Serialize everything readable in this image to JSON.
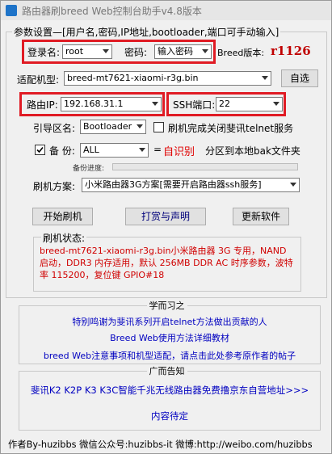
{
  "window": {
    "title": "路由器刷breed Web控制台助手v4.8版本"
  },
  "params": {
    "legend": "参数设置—[用户名,密码,IP地址,bootloader,端口可手动输入]"
  },
  "login": {
    "user_label": "登录名:",
    "user_value": "root",
    "pass_label": "密码:",
    "pass_value": "输入密码",
    "breed_label": "Breed版本:",
    "breed_value": "r1126"
  },
  "model": {
    "label": "适配机型:",
    "value": "breed-mt7621-xiaomi-r3g.bin",
    "button": "自选"
  },
  "network": {
    "ip_label": "路由IP:",
    "ip_value": "192.168.31.1",
    "ssh_label": "SSH端口:",
    "ssh_value": "22"
  },
  "boot": {
    "label": "引导区名:",
    "value": "Bootloader",
    "telnet_label": "刷机完成关闭斐讯telnet服务"
  },
  "backup": {
    "label": "备  份:",
    "value": "ALL",
    "equals": "=",
    "auto": "自识别",
    "partition": "分区到本地bak文件夹",
    "progress_label": "备份进度:",
    "progress": 0
  },
  "plan": {
    "label": "刷机方案:",
    "value": "小米路由器3G方案[需要开启路由器ssh服务]"
  },
  "actions": {
    "start": "开始刷机",
    "reward": "打赏与声明",
    "update": "更新软件"
  },
  "status": {
    "label": "刷机状态:",
    "text": "breed-mt7621-xiaomi-r3g.bin小米路由器 3G 专用，NAND 启动，DDR3 内存适用，默认 256MB DDR AC 时序参数，波特率 115200，复位键 GPIO#18"
  },
  "study": {
    "title": "学而习之",
    "line1": "特别鸣谢为斐讯系列开启telnet方法做出贡献的人",
    "line2": "Breed Web使用方法详细教材",
    "line3": "breed Web注意事项和机型适配，请点击此处参考原作者的帖子"
  },
  "ads": {
    "title": "广而告知",
    "line1": "斐讯K2 K2P K3 K3C智能千兆无线路由器免费撸京东自营地址>>>",
    "line2": "内容待定"
  },
  "footer": {
    "text": "作者By-huzibbs 微信公众号:huzibbs-it 微博:http://weibo.com/huzibbs"
  }
}
